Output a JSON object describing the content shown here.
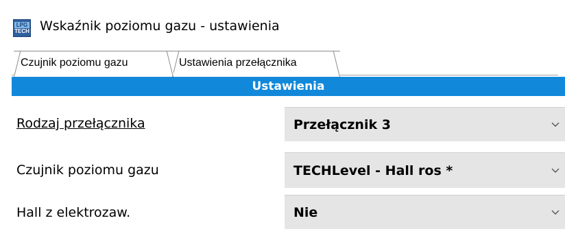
{
  "window": {
    "title": "Wskaźnik poziomu gazu - ustawienia",
    "icon": "lpg-tech-app-icon",
    "icon_text_top": "LPG",
    "icon_text_bottom": "TECH"
  },
  "tabs": [
    {
      "label": "Czujnik poziomu gazu",
      "active": true
    },
    {
      "label": "Ustawienia przełącznika",
      "active": false
    }
  ],
  "section": {
    "header": "Ustawienia",
    "header_color": "#1188d9"
  },
  "settings": [
    {
      "label": "Rodzaj przełącznika",
      "value": "Przełącznik 3"
    },
    {
      "label": "Czujnik poziomu gazu",
      "value": "TECHLevel - Hall ros *"
    },
    {
      "label": "Hall z elektrozaw.",
      "value": "Nie"
    }
  ],
  "icons": {
    "dropdown": "chevron-down-icon"
  }
}
